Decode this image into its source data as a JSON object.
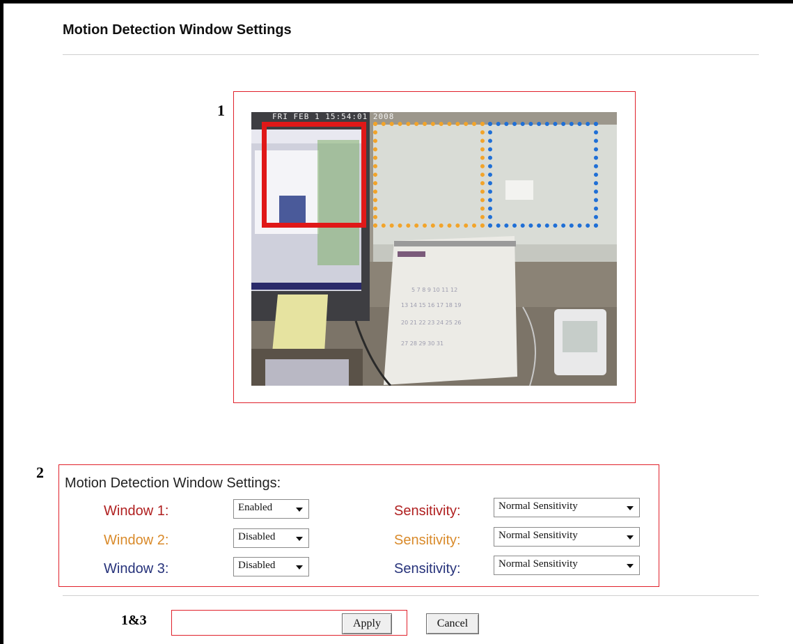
{
  "page": {
    "title": "Motion Detection Window Settings"
  },
  "markers": {
    "preview": "1",
    "settings": "2",
    "buttons": "1&3"
  },
  "preview": {
    "timestamp": "FRI FEB  1 15:54:01 2008",
    "windows": [
      {
        "name": "window-1",
        "color": "#e01818",
        "style": "solid"
      },
      {
        "name": "window-2",
        "color": "#f2a42a",
        "style": "dotted"
      },
      {
        "name": "window-3",
        "color": "#1f6fd6",
        "style": "dotted"
      }
    ]
  },
  "settings": {
    "heading": "Motion Detection Window Settings:",
    "rows": [
      {
        "label": "Window 1:",
        "state": "Enabled",
        "sensitivity_label": "Sensitivity:",
        "sensitivity": "Normal Sensitivity",
        "color": "#b02020"
      },
      {
        "label": "Window 2:",
        "state": "Disabled",
        "sensitivity_label": "Sensitivity:",
        "sensitivity": "Normal Sensitivity",
        "color": "#d98a2a"
      },
      {
        "label": "Window 3:",
        "state": "Disabled",
        "sensitivity_label": "Sensitivity:",
        "sensitivity": "Normal Sensitivity",
        "color": "#26327a"
      }
    ]
  },
  "actions": {
    "apply": "Apply",
    "cancel": "Cancel"
  },
  "colors": {
    "callout": "#e0202a"
  }
}
